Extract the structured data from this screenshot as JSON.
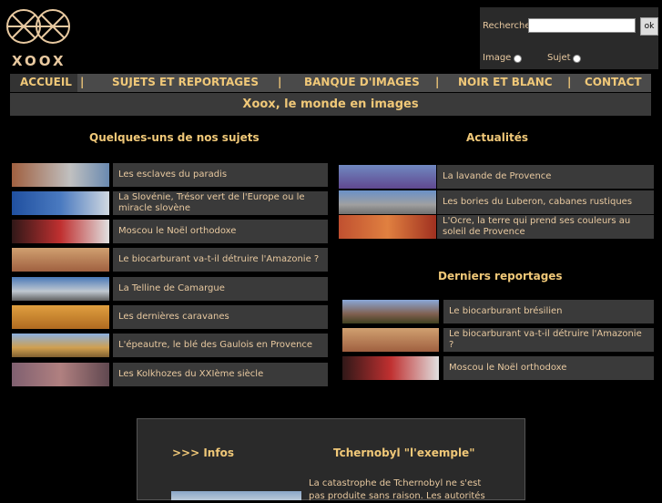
{
  "logo": {
    "text": "XOOX"
  },
  "search": {
    "label": "Recherche",
    "placeholder": "",
    "button_label": "ok",
    "radio_image_label": "Image",
    "radio_sujet_label": "Sujet"
  },
  "nav": {
    "items": [
      "ACCUEIL",
      "SUJETS ET REPORTAGES",
      "BANQUE D'IMAGES",
      "NOIR ET BLANC",
      "CONTACT"
    ],
    "separator": "|"
  },
  "banner": {
    "text": "Xoox, le monde en images"
  },
  "sujets": {
    "title": "Quelques-uns de nos sujets",
    "items": [
      "Les esclaves du paradis",
      "La Slovénie, Trésor vert de l'Europe ou le miracle slovène",
      "Moscou le Noël orthodoxe",
      "Le biocarburant va-t-il détruire l'Amazonie ?",
      "La Telline de Camargue",
      "Les dernières caravanes",
      "L'épeautre, le blé des Gaulois en Provence",
      "Les Kolkhozes du XXIème siècle"
    ]
  },
  "actualites": {
    "title": "Actualités",
    "items": [
      "La lavande de Provence",
      "Les bories du Luberon, cabanes rustiques",
      "L'Ocre, la terre qui prend ses couleurs au soleil de Provence"
    ]
  },
  "reportages": {
    "title": "Derniers reportages",
    "items": [
      "Le biocarburant brésilien",
      "Le biocarburant va-t-il détruire l'Amazonie ?",
      "Moscou le Noël orthodoxe"
    ]
  },
  "infos": {
    "title": ">>> Infos",
    "heading": "Tchernobyl \"l'exemple\"",
    "text": "La catastrophe de Tchernobyl ne s'est pas produite sans raison. Les autorités"
  },
  "colors": {
    "accent": "#f0c878",
    "panel": "#3a3a3a",
    "background": "#000000"
  }
}
